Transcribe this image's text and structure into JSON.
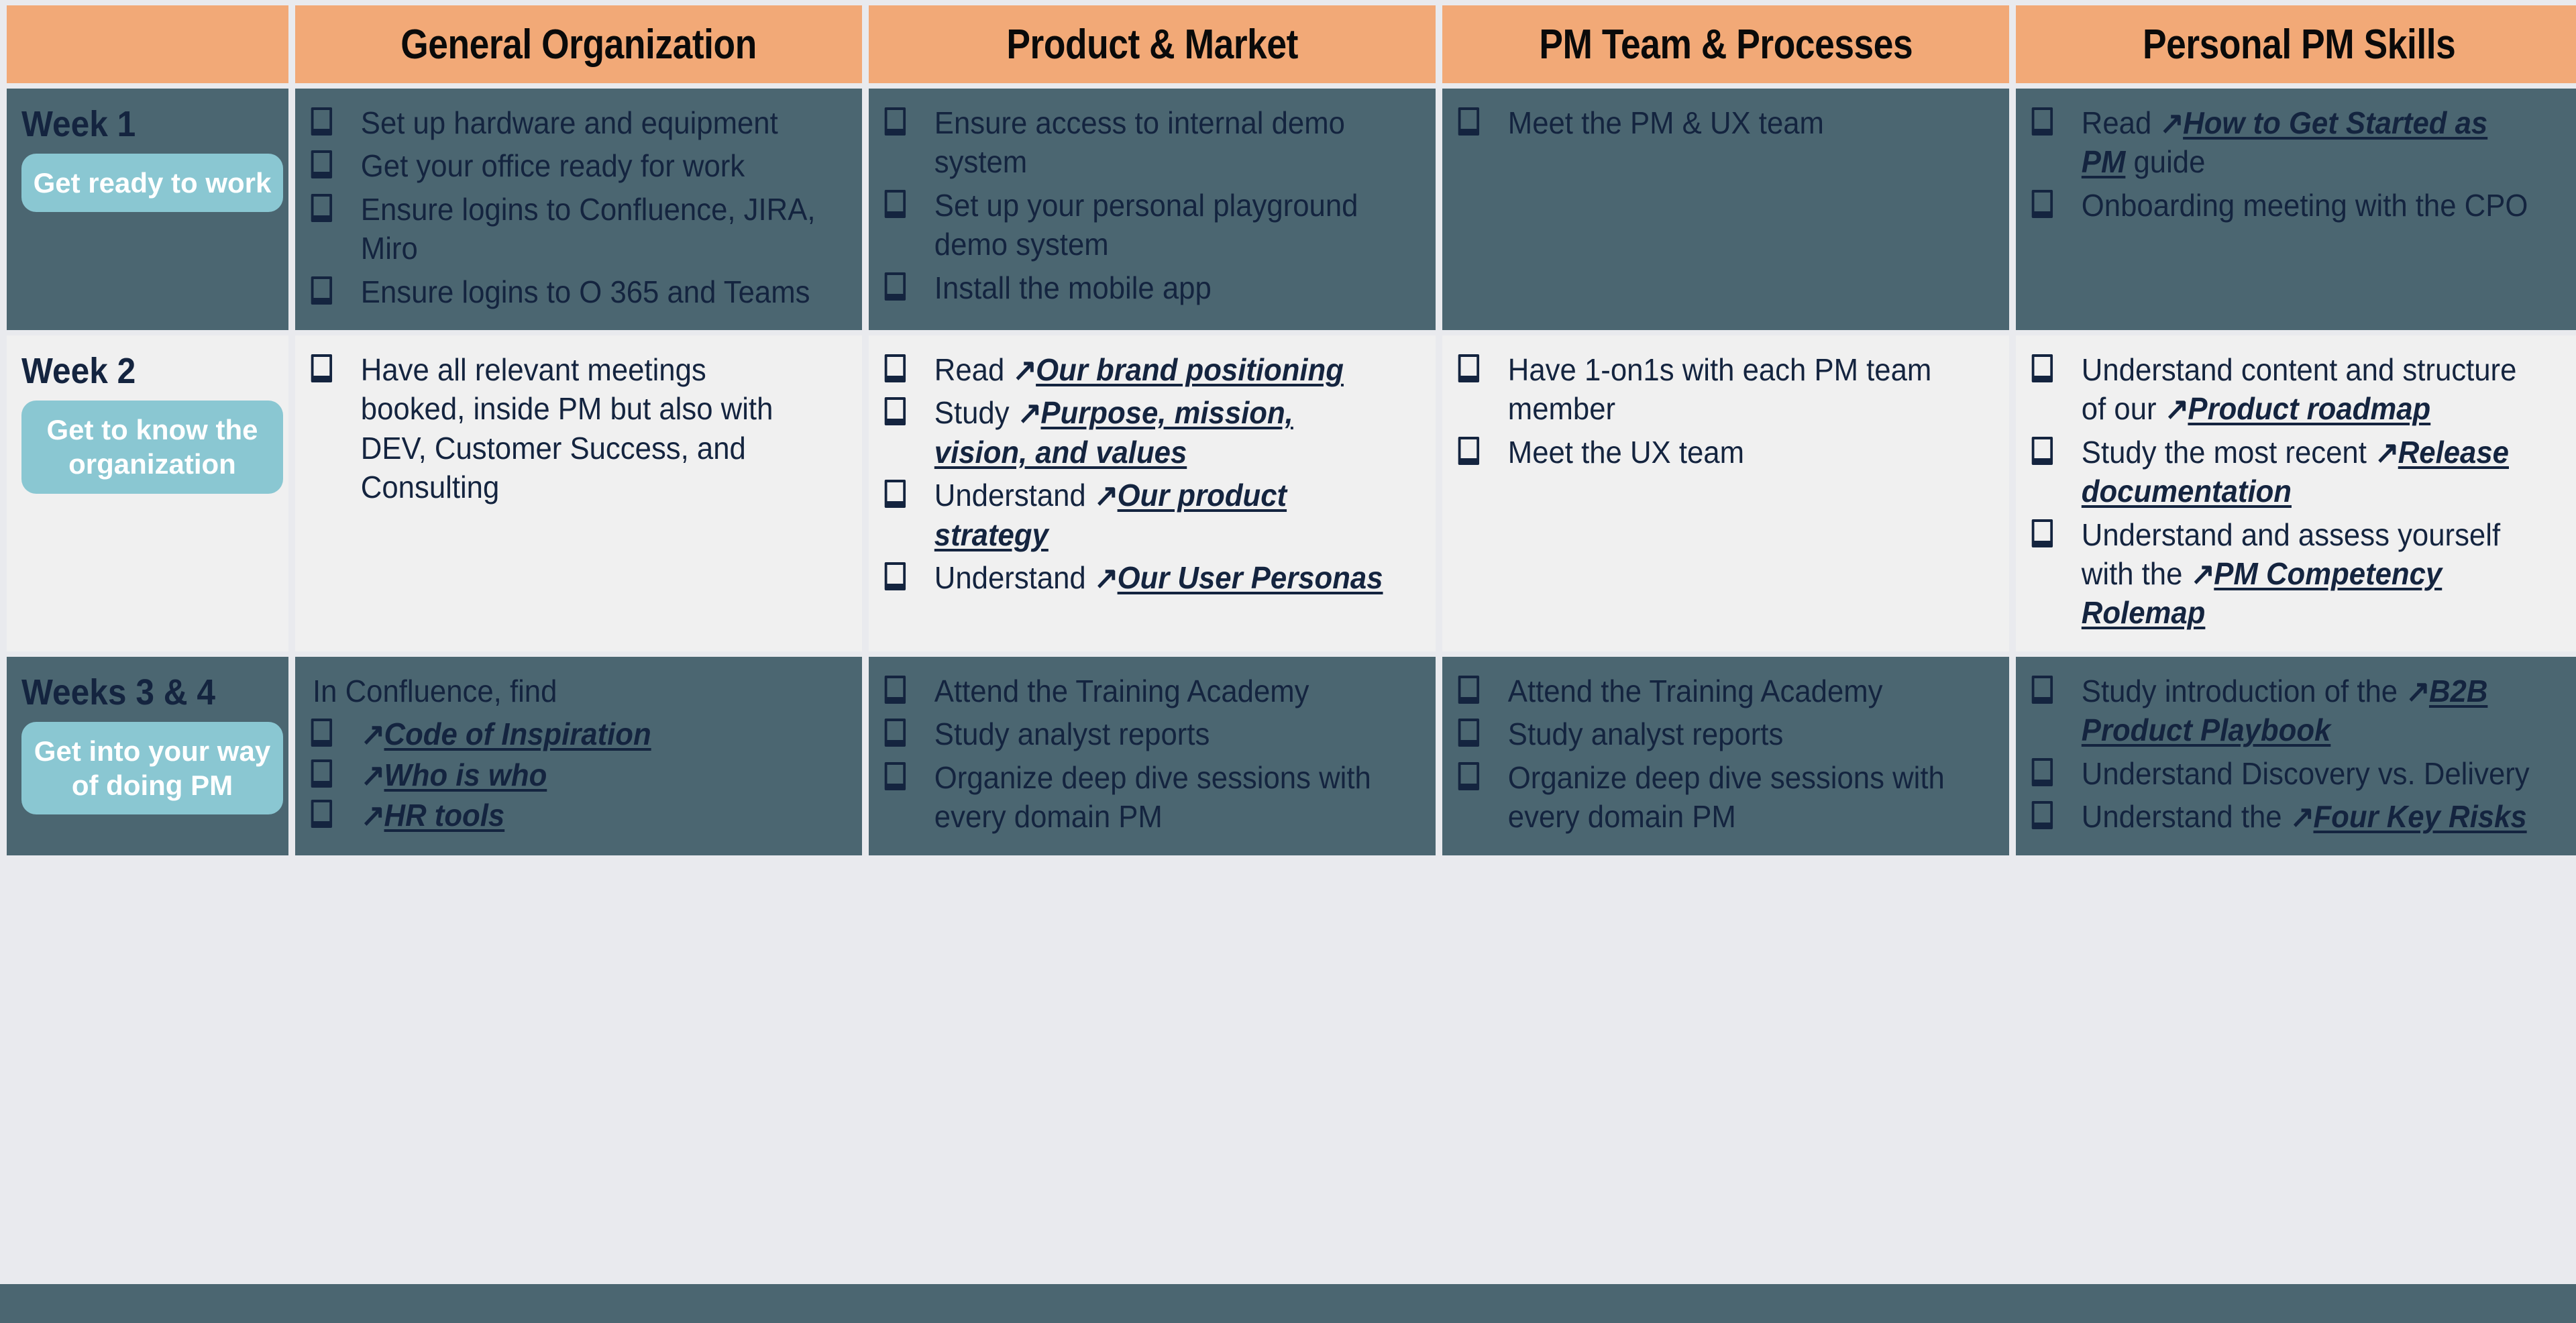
{
  "colors": {
    "header_bg": "#f2a977",
    "dark_row_bg": "#4b6671",
    "light_row_bg": "#f0f0f0",
    "pill_bg": "#8ac7d2",
    "text": "#14243f",
    "page_bg": "#e9eaee"
  },
  "header": {
    "corner": "",
    "columns": [
      "General Organization",
      "Product & Market",
      "PM Team & Processes",
      "Personal PM Skills"
    ]
  },
  "rows": [
    {
      "week_title": "Week 1",
      "pill": "Get ready to work",
      "theme": "dark",
      "cells": [
        {
          "intro": "",
          "items": [
            {
              "parts": [
                {
                  "type": "text",
                  "value": "Set up hardware    and equipment"
                }
              ]
            },
            {
              "parts": [
                {
                  "type": "text",
                  "value": "Get your office ready for work"
                }
              ]
            },
            {
              "parts": [
                {
                  "type": "text",
                  "value": "Ensure logins to Confluence, JIRA, Miro"
                }
              ]
            },
            {
              "parts": [
                {
                  "type": "text",
                  "value": "Ensure logins to O 365 and Teams"
                }
              ]
            }
          ]
        },
        {
          "intro": "",
          "items": [
            {
              "parts": [
                {
                  "type": "text",
                  "value": "Ensure access to internal demo system"
                }
              ]
            },
            {
              "parts": [
                {
                  "type": "text",
                  "value": "Set up your personal playground demo system"
                }
              ]
            },
            {
              "parts": [
                {
                  "type": "text",
                  "value": "Install the mobile app"
                }
              ]
            }
          ]
        },
        {
          "intro": "",
          "items": [
            {
              "parts": [
                {
                  "type": "text",
                  "value": "Meet the PM & UX team"
                }
              ]
            }
          ]
        },
        {
          "intro": "",
          "items": [
            {
              "parts": [
                {
                  "type": "text",
                  "value": "Read "
                },
                {
                  "type": "link",
                  "value": "How to Get Started as PM"
                },
                {
                  "type": "text",
                  "value": " guide"
                }
              ]
            },
            {
              "parts": [
                {
                  "type": "text",
                  "value": "Onboarding meeting with the CPO"
                }
              ]
            }
          ]
        }
      ]
    },
    {
      "week_title": "Week 2",
      "pill": "Get to know the organization",
      "theme": "light",
      "cells": [
        {
          "intro": "",
          "items": [
            {
              "parts": [
                {
                  "type": "text",
                  "value": "Have all relevant meetings booked, inside PM but also with DEV, Customer Success, and Consulting"
                }
              ]
            }
          ]
        },
        {
          "intro": "",
          "items": [
            {
              "parts": [
                {
                  "type": "text",
                  "value": "Read "
                },
                {
                  "type": "link",
                  "value": "Our brand positioning"
                }
              ]
            },
            {
              "parts": [
                {
                  "type": "text",
                  "value": "Study "
                },
                {
                  "type": "link",
                  "value": "Purpose, mission, vision, and values"
                }
              ]
            },
            {
              "parts": [
                {
                  "type": "text",
                  "value": "Understand "
                },
                {
                  "type": "link",
                  "value": "Our product strategy"
                }
              ]
            },
            {
              "parts": [
                {
                  "type": "text",
                  "value": "Understand "
                },
                {
                  "type": "link",
                  "value": "Our User Personas"
                }
              ]
            }
          ]
        },
        {
          "intro": "",
          "items": [
            {
              "parts": [
                {
                  "type": "text",
                  "value": "Have 1-on1s with each PM team member"
                }
              ]
            },
            {
              "parts": [
                {
                  "type": "text",
                  "value": "Meet the UX team"
                }
              ]
            }
          ]
        },
        {
          "intro": "",
          "items": [
            {
              "parts": [
                {
                  "type": "text",
                  "value": "Understand content and structure of our "
                },
                {
                  "type": "link",
                  "value": "Product roadmap"
                }
              ]
            },
            {
              "parts": [
                {
                  "type": "text",
                  "value": "Study the most recent "
                },
                {
                  "type": "link",
                  "value": "Release documentation"
                }
              ]
            },
            {
              "parts": [
                {
                  "type": "text",
                  "value": "Understand and assess yourself with the "
                },
                {
                  "type": "link",
                  "value": "PM Competency Rolemap"
                }
              ]
            }
          ]
        }
      ]
    },
    {
      "week_title": "Weeks 3 & 4",
      "pill": "Get into your way of doing PM",
      "theme": "dark",
      "cells": [
        {
          "intro": "In Confluence, find",
          "items": [
            {
              "parts": [
                {
                  "type": "link",
                  "value": "Code of Inspiration"
                }
              ]
            },
            {
              "parts": [
                {
                  "type": "link",
                  "value": "Who is who"
                }
              ]
            },
            {
              "parts": [
                {
                  "type": "link",
                  "value": "HR tools"
                }
              ]
            }
          ]
        },
        {
          "intro": "",
          "items": [
            {
              "parts": [
                {
                  "type": "text",
                  "value": "Attend the Training Academy"
                }
              ]
            },
            {
              "parts": [
                {
                  "type": "text",
                  "value": "Study analyst reports"
                }
              ]
            },
            {
              "parts": [
                {
                  "type": "text",
                  "value": "Organize deep dive sessions with every domain PM"
                }
              ]
            }
          ]
        },
        {
          "intro": "",
          "items": [
            {
              "parts": [
                {
                  "type": "text",
                  "value": "Attend the Training Academy"
                }
              ]
            },
            {
              "parts": [
                {
                  "type": "text",
                  "value": "Study analyst reports"
                }
              ]
            },
            {
              "parts": [
                {
                  "type": "text",
                  "value": "Organize deep dive sessions with every domain PM"
                }
              ]
            }
          ]
        },
        {
          "intro": "",
          "items": [
            {
              "parts": [
                {
                  "type": "text",
                  "value": "Study introduction of the "
                },
                {
                  "type": "link",
                  "value": "B2B Product Playbook"
                }
              ]
            },
            {
              "parts": [
                {
                  "type": "text",
                  "value": "Understand Discovery vs. Delivery"
                }
              ]
            },
            {
              "parts": [
                {
                  "type": "text",
                  "value": "Understand the "
                },
                {
                  "type": "link",
                  "value": "Four Key Risks"
                }
              ]
            }
          ]
        }
      ]
    }
  ],
  "icons": {
    "checkbox": "checkbox-icon",
    "external_link_arrow": "↗"
  }
}
